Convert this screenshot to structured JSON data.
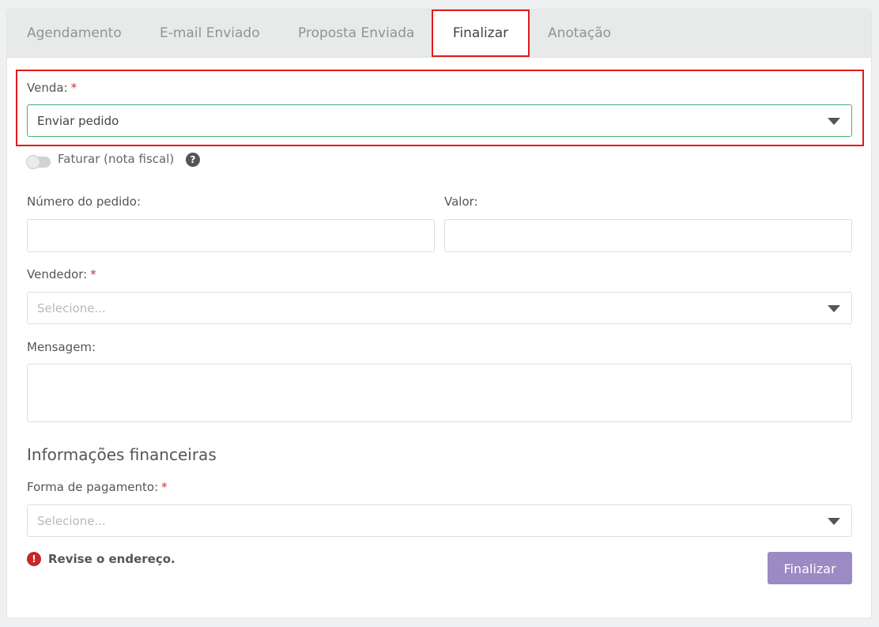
{
  "tabs": [
    {
      "label": "Agendamento"
    },
    {
      "label": "E-mail Enviado"
    },
    {
      "label": "Proposta Enviada"
    },
    {
      "label": "Finalizar"
    },
    {
      "label": "Anotação"
    }
  ],
  "active_tab": "Finalizar",
  "form": {
    "venda": {
      "label": "Venda:",
      "required": "*",
      "value": "Enviar pedido"
    },
    "faturar": {
      "label": "Faturar (nota fiscal)",
      "enabled": false,
      "help_icon": "question-circle-icon"
    },
    "numero_pedido": {
      "label": "Número do pedido:",
      "value": ""
    },
    "valor": {
      "label": "Valor:",
      "value": ""
    },
    "vendedor": {
      "label": "Vendedor:",
      "required": "*",
      "placeholder": "Selecione..."
    },
    "mensagem": {
      "label": "Mensagem:",
      "value": ""
    }
  },
  "financeiro": {
    "title": "Informações financeiras",
    "forma_pagamento": {
      "label": "Forma de pagamento:",
      "required": "*",
      "placeholder": "Selecione..."
    }
  },
  "error": {
    "icon": "exclamation-circle-icon",
    "text": "Revise o endereço."
  },
  "actions": {
    "finalizar_label": "Finalizar"
  },
  "colors": {
    "highlight_border": "#e11b1b",
    "required_marker": "#c0392b",
    "valid_border": "#4caf7a",
    "primary_button": "#9b8ac4",
    "error_icon": "#c62828"
  }
}
